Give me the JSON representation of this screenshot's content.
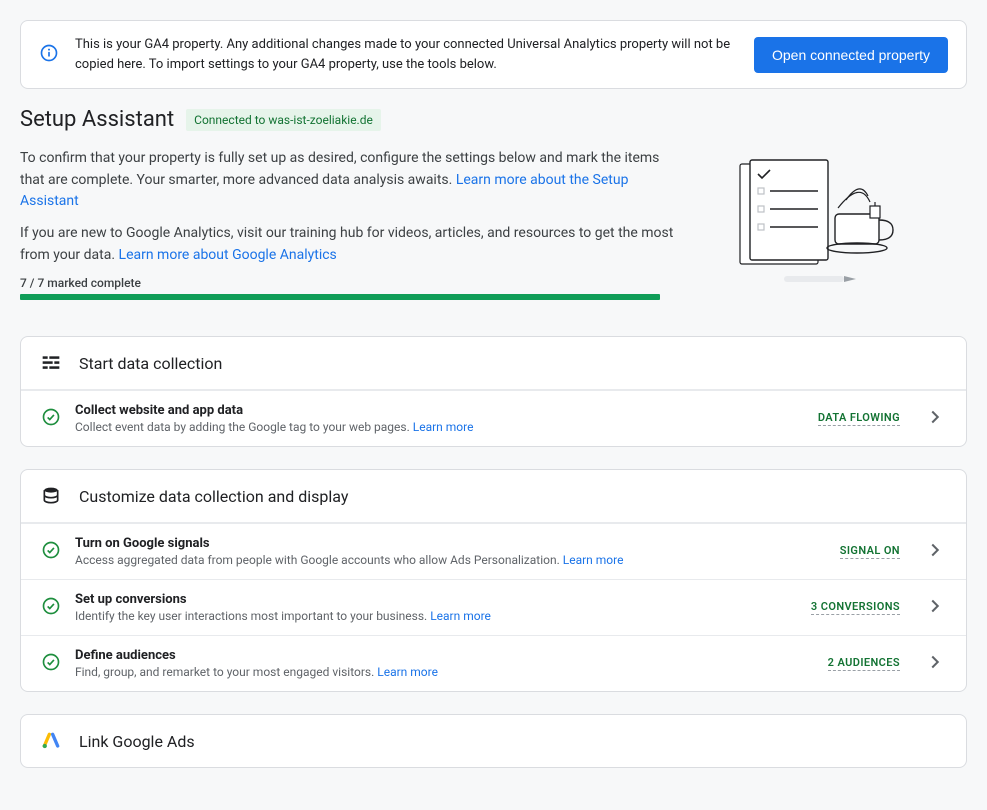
{
  "alert": {
    "text": "This is your GA4 property. Any additional changes made to your connected Universal Analytics property will not be copied here. To import settings to your GA4 property, use the tools below.",
    "button": "Open connected property"
  },
  "header": {
    "title": "Setup Assistant",
    "badge": "Connected to was-ist-zoeliakie.de"
  },
  "intro": {
    "p1a": "To confirm that your property is fully set up as desired, configure the settings below and mark the items that are complete. Your smarter, more advanced data analysis awaits. ",
    "link1": "Learn more about the Setup Assistant",
    "p2a": "If you are new to Google Analytics, visit our training hub for videos, articles, and resources to get the most from your data. ",
    "link2": "Learn more about Google Analytics"
  },
  "progress": {
    "label": "7 / 7 marked complete"
  },
  "sections": {
    "s1": {
      "title": "Start data collection"
    },
    "s2": {
      "title": "Customize data collection and display"
    },
    "s3": {
      "title": "Link Google Ads"
    }
  },
  "rows": {
    "r1": {
      "title": "Collect website and app data",
      "desc": "Collect event data by adding the Google tag to your web pages. ",
      "learn": "Learn more",
      "status": "DATA FLOWING"
    },
    "r2": {
      "title": "Turn on Google signals",
      "desc": "Access aggregated data from people with Google accounts who allow Ads Personalization. ",
      "learn": "Learn more",
      "status": "SIGNAL ON"
    },
    "r3": {
      "title": "Set up conversions",
      "desc": "Identify the key user interactions most important to your business. ",
      "learn": "Learn more",
      "status": "3 CONVERSIONS"
    },
    "r4": {
      "title": "Define audiences",
      "desc": "Find, group, and remarket to your most engaged visitors. ",
      "learn": "Learn more",
      "status": "2 AUDIENCES"
    }
  }
}
